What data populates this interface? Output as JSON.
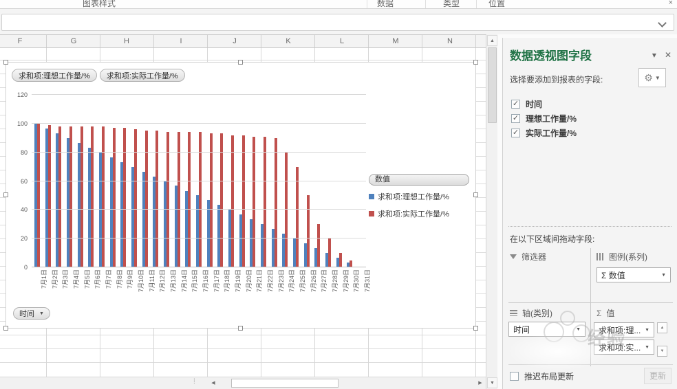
{
  "ribbon": {
    "groups": [
      "图表样式",
      "数据",
      "类型",
      "位置"
    ],
    "close_icon": "×"
  },
  "sheet": {
    "columns": [
      "F",
      "G",
      "H",
      "I",
      "J",
      "K",
      "L",
      "M",
      "N"
    ]
  },
  "chart": {
    "field_buttons": [
      {
        "label": "求和项:理想工作量/%"
      },
      {
        "label": "求和项:实际工作量/%"
      }
    ],
    "legend_title": "数值",
    "axis_field_button": "时间"
  },
  "chart_data": {
    "type": "bar",
    "title": "",
    "xlabel": "",
    "ylabel": "",
    "categories": [
      "7月1日",
      "7月2日",
      "7月3日",
      "7月4日",
      "7月5日",
      "7月6日",
      "7月7日",
      "7月8日",
      "7月9日",
      "7月10日",
      "7月11日",
      "7月12日",
      "7月13日",
      "7月14日",
      "7月15日",
      "7月16日",
      "7月17日",
      "7月18日",
      "7月19日",
      "7月20日",
      "7月21日",
      "7月22日",
      "7月23日",
      "7月24日",
      "7月25日",
      "7月26日",
      "7月27日",
      "7月28日",
      "7月29日",
      "7月30日",
      "7月31日"
    ],
    "series": [
      {
        "name": "求和项:理想工作量/%",
        "color": "#4F81BD",
        "values": [
          100,
          96.7,
          93.3,
          90,
          86.7,
          83.3,
          80,
          76.7,
          73.3,
          70,
          66.7,
          63.3,
          60,
          56.7,
          53.3,
          50,
          46.7,
          43.3,
          40,
          36.7,
          33.3,
          30,
          26.7,
          23.3,
          20,
          16.7,
          13.3,
          10,
          6.7,
          3.3,
          0
        ]
      },
      {
        "name": "求和项:实际工作量/%",
        "color": "#C0504D",
        "values": [
          100,
          99,
          98,
          98,
          98,
          98,
          98,
          97,
          97,
          96,
          95,
          95,
          94,
          94,
          94,
          94,
          93,
          93,
          92,
          92,
          91,
          91,
          90,
          80,
          70,
          50,
          30,
          20,
          10,
          5,
          0
        ]
      }
    ],
    "ylim": [
      0,
      120
    ],
    "yticks": [
      0,
      20,
      40,
      60,
      80,
      100,
      120
    ],
    "grid": true,
    "legend_position": "right"
  },
  "panel": {
    "title": "数据透视图字段",
    "collapse_icon": "▾",
    "close_icon": "✕",
    "subtitle": "选择要添加到报表的字段:",
    "gear_icon": "⚙",
    "fields": [
      {
        "label": "时间",
        "checked": true
      },
      {
        "label": "理想工作量/%",
        "checked": true
      },
      {
        "label": "实际工作量/%",
        "checked": true
      }
    ],
    "drag_hint": "在以下区域间拖动字段:",
    "areas": {
      "filters": {
        "label": "筛选器",
        "items": []
      },
      "legend": {
        "label": "图例(系列)",
        "items": [
          {
            "label": "数值",
            "sigma": true
          }
        ]
      },
      "axis": {
        "label": "轴(类别)",
        "items": [
          {
            "label": "时间",
            "sigma": false
          }
        ]
      },
      "values": {
        "label": "值",
        "items": [
          {
            "label": "求和项:理...",
            "sigma": false
          },
          {
            "label": "求和项:实...",
            "sigma": false
          }
        ]
      }
    },
    "defer_label": "推迟布局更新",
    "update_label": "更新"
  },
  "watermark": {
    "text": "经验"
  }
}
